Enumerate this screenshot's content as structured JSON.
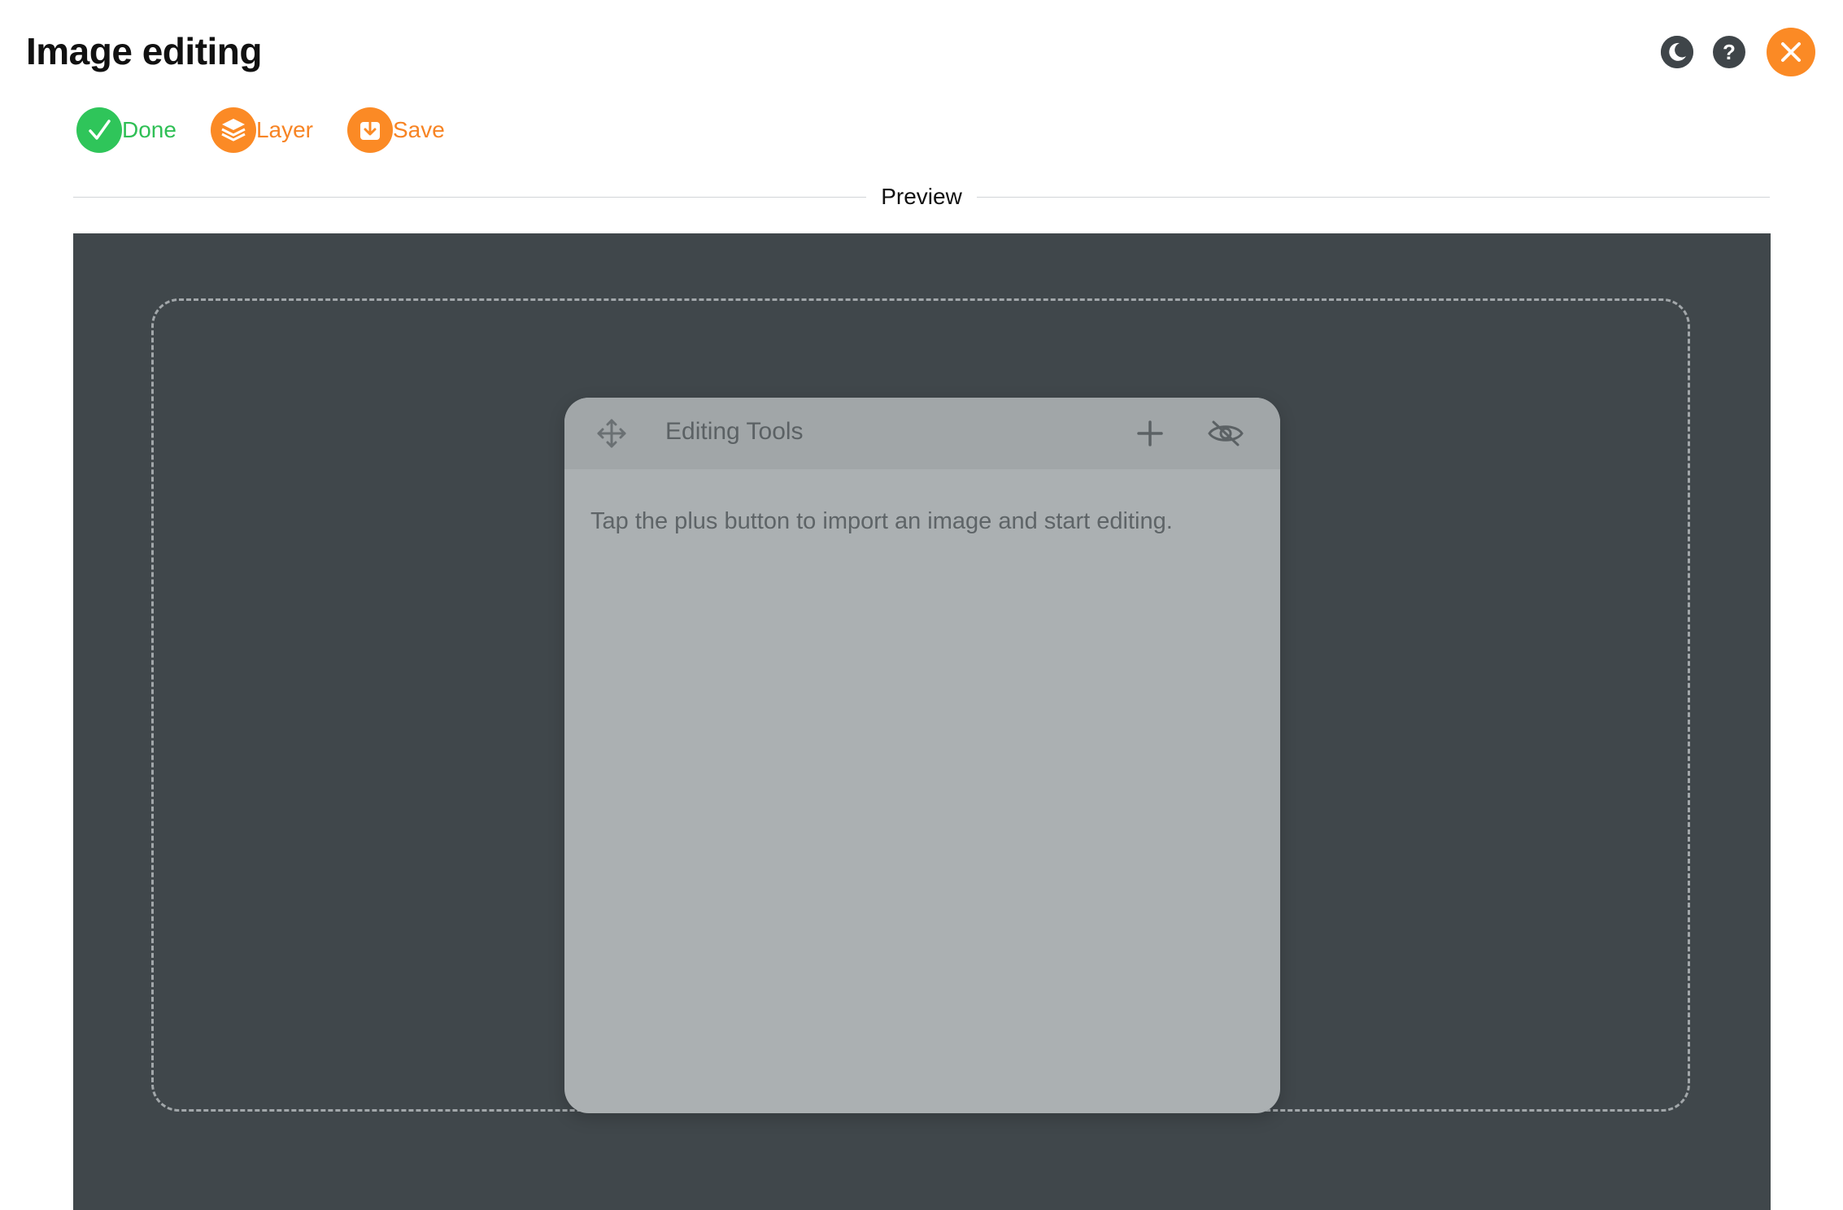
{
  "header": {
    "title": "Image editing"
  },
  "top_actions": [
    {
      "name": "dark-mode",
      "icon": "moon-icon"
    },
    {
      "name": "help",
      "icon": "question-icon",
      "glyph": "?"
    },
    {
      "name": "close",
      "icon": "close-icon"
    }
  ],
  "toolbar": {
    "done_label": "Done",
    "layer_label": "Layer",
    "save_label": "Save"
  },
  "preview": {
    "section_label": "Preview"
  },
  "editing_panel": {
    "title": "Editing Tools",
    "hint": "Tap the plus button to import an image and start editing."
  },
  "colors": {
    "accent_orange": "#fb8a25",
    "done_green": "#2fc55a",
    "canvas_bg": "#40474b",
    "panel_bg": "#abb0b2"
  }
}
